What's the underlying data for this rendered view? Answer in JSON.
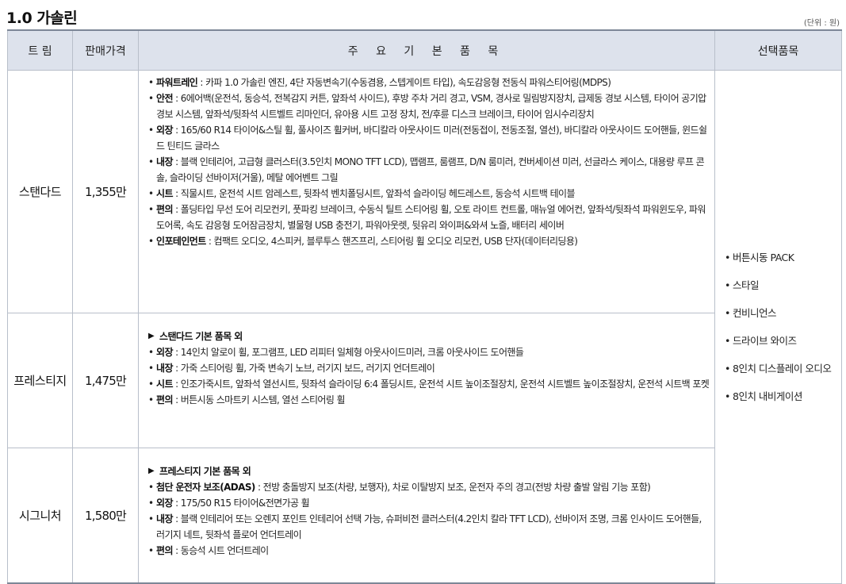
{
  "title": "1.0 가솔린",
  "unit_note": "(단위 : 원)",
  "headers": {
    "trim": "트 림",
    "price": "판매가격",
    "features": "주 요 기 본 품 목",
    "options": "선택품목"
  },
  "bullet_char": "•",
  "arrow_char": "▶",
  "trims": [
    {
      "name": "스탠다드",
      "price": "1,355만",
      "base": "",
      "features": [
        {
          "label": "파워트레인",
          "text": " : 카파 1.0 가솔린 엔진, 4단 자동변속기(수동겸용, 스텝게이트 타입), 속도감응형 전동식 파워스티어링(MDPS)"
        },
        {
          "label": "안전",
          "text": " : 6에어백(운전석, 동승석, 전복감지 커튼, 앞좌석 사이드), 후방 주차 거리 경고, VSM, 경사로 밀림방지장치, 급제동 경보 시스템, 타이어 공기압 경보 시스템, 앞좌석/뒷좌석 시트벨트 리마인더, 유아용 시트 고정 장치, 전/후륜 디스크 브레이크, 타이어 임시수리장치"
        },
        {
          "label": "외장",
          "text": " : 165/60 R14 타이어&스틸 휠, 풀사이즈 휠커버, 바디칼라 아웃사이드 미러(전동접이, 전동조절, 열선), 바디칼라 아웃사이드 도어핸들, 윈드쉴드 틴티드 글라스"
        },
        {
          "label": "내장",
          "text": " : 블랙 인테리어, 고급형 클러스터(3.5인치 MONO TFT LCD), 맵램프, 룸램프, D/N 룸미러, 컨버세이션 미러, 선글라스 케이스, 대용량 루프 콘솔, 슬라이딩 선바이저(거울), 메탈 에어벤트 그릴"
        },
        {
          "label": "시트",
          "text": " : 직물시트, 운전석 시트 암레스트, 뒷좌석 벤치폴딩시트, 앞좌석 슬라이딩 헤드레스트, 동승석 시트백 테이블"
        },
        {
          "label": "편의",
          "text": " : 폴딩타입 무선 도어 리모컨키, 풋파킹 브레이크, 수동식 틸트 스티어링 휠, 오토 라이트 컨트롤, 매뉴얼 에어컨, 앞좌석/뒷좌석 파워윈도우, 파워도어록, 속도 감응형 도어잠금장치, 별물형 USB 충전기, 파워아웃렛, 뒷유리 와이퍼&와셔 노즐, 배터리 세이버"
        },
        {
          "label": "인포테인먼트",
          "text": " : 컴팩트 오디오, 4스피커, 블루투스 핸즈프리, 스티어링 휠 오디오 리모컨, USB 단자(데이터리딩용)"
        }
      ]
    },
    {
      "name": "프레스티지",
      "price": "1,475만",
      "base": "스탠다드 기본 품목 외",
      "features": [
        {
          "label": "외장",
          "text": " : 14인치 알로이 휠, 포그램프, LED 리피터 일체형 아웃사이드미러, 크롬 아웃사이드 도어핸들"
        },
        {
          "label": "내장",
          "text": " : 가죽 스티어링 휠, 가죽 변속기 노브, 러기지 보드, 러기지 언더트레이"
        },
        {
          "label": "시트",
          "text": " : 인조가죽시트, 앞좌석 열선시트, 뒷좌석 슬라이딩 6:4 폴딩시트, 운전석 시트 높이조절장치, 운전석 시트벨트 높이조절장치, 운전석 시트백 포켓"
        },
        {
          "label": "편의",
          "text": " : 버튼시동 스마트키 시스템, 열선 스티어링 휠"
        }
      ]
    },
    {
      "name": "시그니처",
      "price": "1,580만",
      "base": "프레스티지 기본 품목 외",
      "features": [
        {
          "label": "첨단 운전자 보조(ADAS)",
          "text": " : 전방 충돌방지 보조(차량, 보행자), 차로 이탈방지 보조, 운전자 주의 경고(전방 차량 출발 알림 기능 포함)"
        },
        {
          "label": "외장",
          "text": " : 175/50 R15 타이어&전면가공 휠"
        },
        {
          "label": "내장",
          "text": " : 블랙 인테리어 또는 오렌지 포인트 인테리어 선택 가능, 슈퍼비전 클러스터(4.2인치 칼라 TFT LCD), 선바이저 조명, 크롬 인사이드 도어핸들, 러기지 네트, 뒷좌석 플로어 언더트레이"
        },
        {
          "label": "편의",
          "text": " : 동승석 시트 언더트레이"
        }
      ]
    }
  ],
  "options": [
    "버튼시동 PACK",
    "스타일",
    "컨비니언스",
    "드라이브 와이즈",
    "8인치 디스플레이 오디오",
    "8인치 내비게이션"
  ]
}
